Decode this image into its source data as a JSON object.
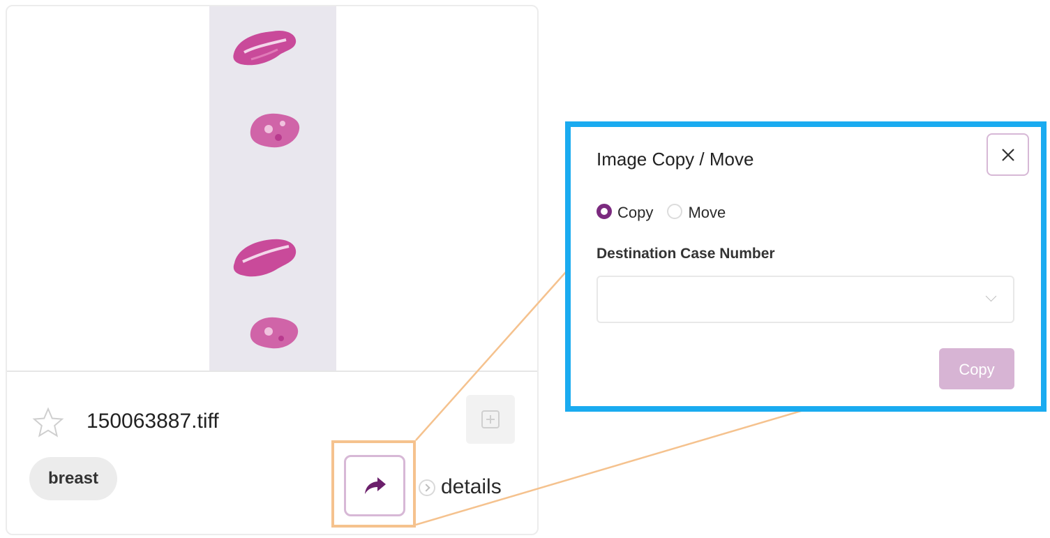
{
  "card": {
    "filename": "150063887.tiff",
    "tag": "breast",
    "details_label": "details",
    "icons": {
      "favorite": "star-outline-icon",
      "add": "plus-square-icon",
      "share": "share-arrow-icon",
      "details": "chevron-right-circle-icon"
    }
  },
  "dialog": {
    "title": "Image Copy / Move",
    "options": [
      {
        "label": "Copy",
        "selected": true
      },
      {
        "label": "Move",
        "selected": false
      }
    ],
    "field_label": "Destination Case Number",
    "select_value": "",
    "submit_label": "Copy",
    "close_icon": "close-icon"
  },
  "colors": {
    "accent_purple": "#7b2a7f",
    "button_disabled": "#d7b4d4",
    "highlight_blue": "#1aabf0",
    "highlight_orange": "#f5c28e"
  }
}
